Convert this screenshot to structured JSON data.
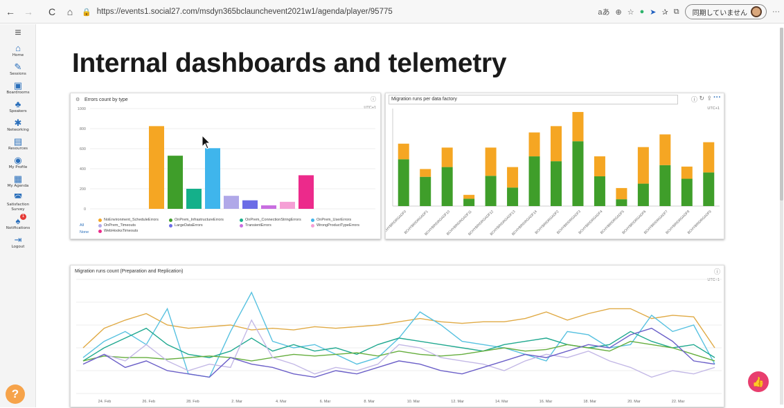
{
  "browser": {
    "url": "https://events1.social27.com/msdyn365bclaunchevent2021w1/agenda/player/95775",
    "sync_label": "同期していません",
    "nav": [
      "←",
      "→",
      "C",
      "⌂"
    ]
  },
  "sidebar": {
    "items": [
      {
        "label": "Home",
        "icon": "home-icon",
        "glyph": "⌂"
      },
      {
        "label": "Sessions",
        "icon": "pencil-icon",
        "glyph": "✎"
      },
      {
        "label": "Boardrooms",
        "icon": "boardroom-icon",
        "glyph": "▣"
      },
      {
        "label": "Speakers",
        "icon": "speakers-icon",
        "glyph": "♣"
      },
      {
        "label": "Networking",
        "icon": "network-icon",
        "glyph": "✱"
      },
      {
        "label": "Resources",
        "icon": "resources-icon",
        "glyph": "▤"
      },
      {
        "label": "My Profile",
        "icon": "profile-icon",
        "glyph": "◉"
      },
      {
        "label": "My Agenda",
        "icon": "agenda-icon",
        "glyph": "▦"
      },
      {
        "label": "Satisfaction Survey",
        "icon": "survey-icon",
        "glyph": "◚"
      },
      {
        "label": "Notifications",
        "icon": "bell-icon",
        "glyph": "♠",
        "badge": "1"
      },
      {
        "label": "Logout",
        "icon": "logout-icon",
        "glyph": "⇥"
      }
    ],
    "help": "?"
  },
  "page": {
    "title": "Internal dashboards and telemetry"
  },
  "chart_data": [
    {
      "type": "bar",
      "title": "Errors count by type",
      "utc": "UTC+1",
      "ylim": [
        0,
        1000
      ],
      "yticks": [
        0,
        200,
        400,
        600,
        800,
        1000
      ],
      "grid": true,
      "categories": [
        "NoEnvironment_ScheduleErrors",
        "OnPrem_InfrastructureErrors",
        "OnPrem_ConnectionStringErrors",
        "OnPrem_UserErrors",
        "OnPrem_Timeouts",
        "LargeDataErrors",
        "TransientErrors",
        "WrongProductTypeErrors",
        "WebHooksTimeouts"
      ],
      "values": [
        825,
        530,
        200,
        605,
        130,
        85,
        35,
        70,
        335
      ],
      "colors": [
        "#f5a623",
        "#3f9e2a",
        "#14b08a",
        "#3fb5ec",
        "#b0a8e8",
        "#6b6ce6",
        "#c86ee0",
        "#f59fd5",
        "#ec2a8b"
      ],
      "legend_links": [
        "All",
        "None"
      ]
    },
    {
      "type": "bar",
      "title": "Migration runs per data factory",
      "utc": "UTC+1",
      "stacked": true,
      "categories": [
        "BCHYBRIDRGADF0",
        "BCHYBRIDRGADF1",
        "BCHYBRIDRGADF10",
        "BCHYBRIDRGADF11",
        "BCHYBRIDRGADF12",
        "BCHYBRIDRGADF13",
        "BCHYBRIDRGADF14",
        "BCHYBRIDRGADF2",
        "BCHYBRIDRGADF3",
        "BCHYBRIDRGADF4",
        "BCHYBRIDRGADF5",
        "BCHYBRIDRGADF6",
        "BCHYBRIDRGADF7",
        "BCHYBRIDRGADF8",
        "BCHYBRIDRGADF9"
      ],
      "series": [
        {
          "color": "#3f9e2a",
          "values": [
            480,
            300,
            400,
            75,
            310,
            190,
            510,
            460,
            665,
            305,
            70,
            230,
            420,
            280,
            345
          ]
        },
        {
          "color": "#f5a623",
          "values": [
            160,
            80,
            200,
            40,
            290,
            210,
            245,
            360,
            300,
            205,
            115,
            375,
            315,
            125,
            310
          ]
        }
      ]
    },
    {
      "type": "line",
      "title": "Migration runs count (Preparation and Replication)",
      "utc": "UTC+1",
      "grid": true,
      "x_ticks": [
        "24. Feb",
        "26. Feb",
        "28. Feb",
        "2. Mar",
        "4. Mar",
        "6. Mar",
        "8. Mar",
        "10. Mar",
        "12. Mar",
        "14. Mar",
        "16. Mar",
        "18. Mar",
        "20. Mar",
        "22. Mar"
      ],
      "series": [
        {
          "color": "#e0aa45",
          "values": [
            28,
            40,
            45,
            49,
            42,
            40,
            41,
            42,
            39,
            40,
            39,
            41,
            40,
            41,
            42,
            44,
            46,
            44,
            43,
            44,
            44,
            46,
            50,
            45,
            49,
            52,
            52,
            46,
            48,
            47,
            28
          ]
        },
        {
          "color": "#57c1e0",
          "values": [
            22,
            32,
            38,
            30,
            52,
            12,
            10,
            38,
            62,
            32,
            28,
            30,
            24,
            18,
            22,
            34,
            50,
            42,
            32,
            30,
            28,
            24,
            20,
            38,
            36,
            28,
            30,
            48,
            38,
            42,
            18
          ]
        },
        {
          "color": "#1fa88f",
          "values": [
            20,
            28,
            34,
            40,
            30,
            24,
            22,
            26,
            34,
            26,
            30,
            26,
            28,
            24,
            30,
            34,
            32,
            30,
            28,
            26,
            30,
            32,
            34,
            30,
            28,
            30,
            38,
            32,
            28,
            30,
            22
          ]
        },
        {
          "color": "#64ad3c",
          "values": [
            20,
            23,
            22,
            22,
            21,
            22,
            23,
            22,
            20,
            22,
            24,
            23,
            24,
            25,
            23,
            26,
            24,
            23,
            24,
            26,
            28,
            26,
            27,
            30,
            28,
            26,
            32,
            30,
            28,
            24,
            20
          ]
        },
        {
          "color": "#c3b8e6",
          "values": [
            18,
            24,
            20,
            30,
            20,
            14,
            18,
            16,
            45,
            22,
            18,
            12,
            16,
            14,
            18,
            30,
            28,
            22,
            20,
            18,
            14,
            20,
            24,
            22,
            26,
            20,
            16,
            10,
            14,
            12,
            16
          ]
        },
        {
          "color": "#6b5fc8",
          "values": [
            18,
            24,
            16,
            20,
            14,
            12,
            10,
            22,
            18,
            16,
            12,
            10,
            14,
            12,
            16,
            20,
            18,
            14,
            12,
            16,
            20,
            24,
            22,
            26,
            30,
            28,
            36,
            40,
            32,
            20,
            18
          ]
        }
      ]
    }
  ],
  "like_label": "👍"
}
